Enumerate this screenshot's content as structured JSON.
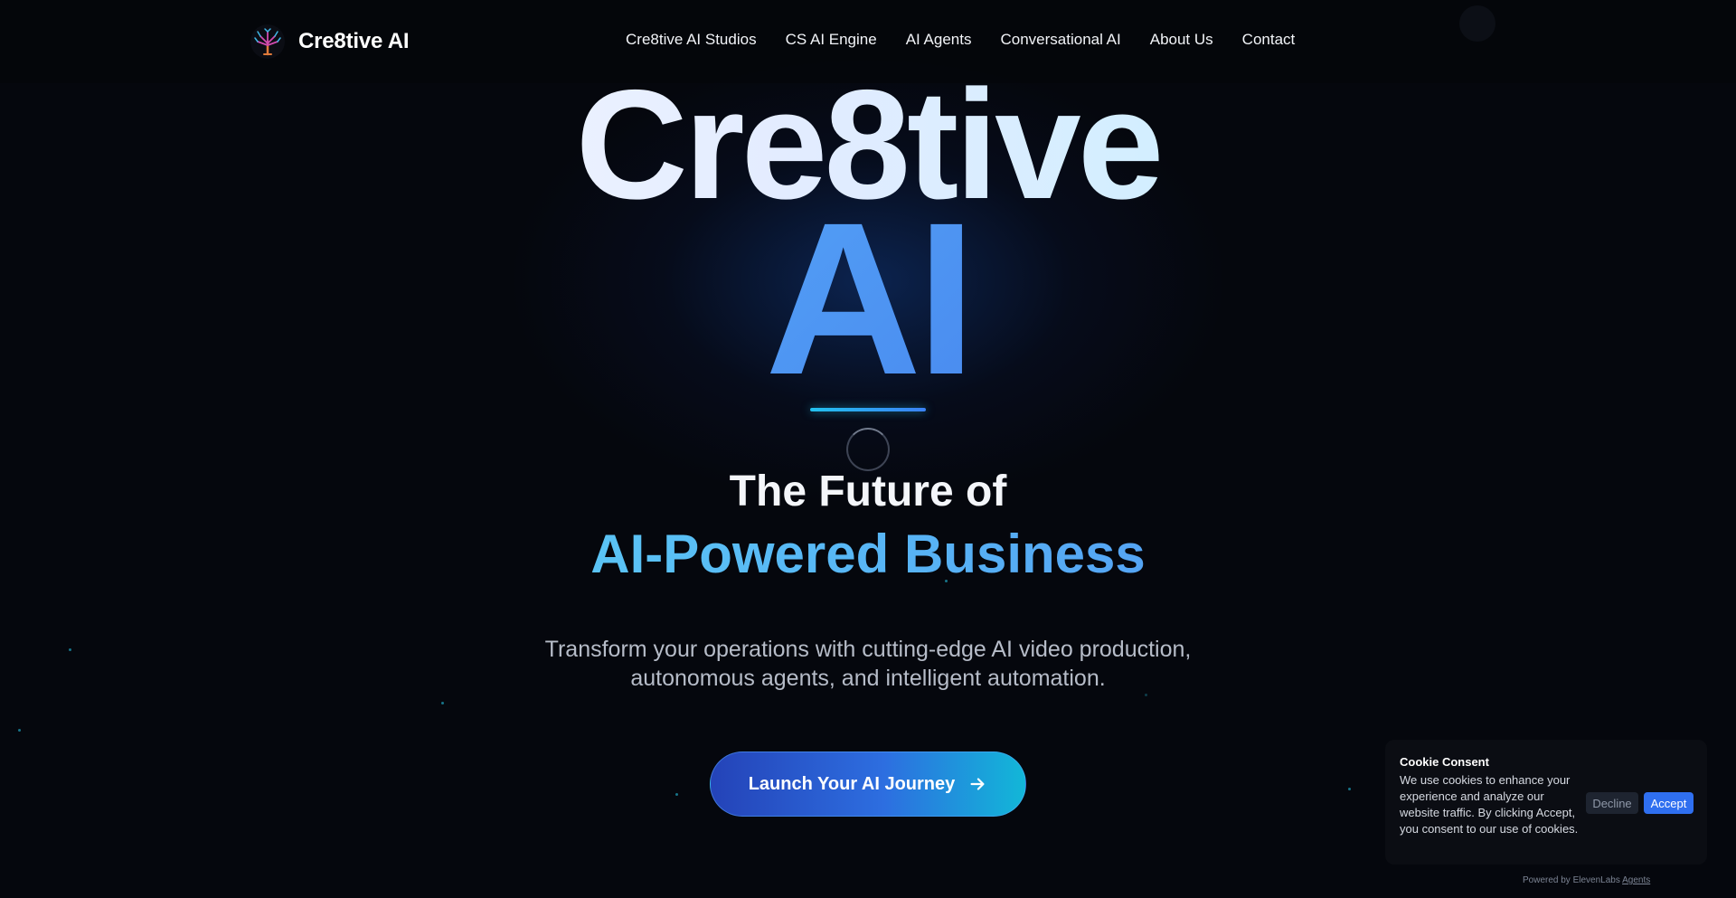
{
  "brand": {
    "name": "Cre8tive AI",
    "logo_icon": "tree-icon"
  },
  "nav": {
    "items": [
      {
        "label": "Cre8tive AI Studios"
      },
      {
        "label": "CS AI Engine"
      },
      {
        "label": "AI Agents"
      },
      {
        "label": "Conversational AI"
      },
      {
        "label": "About Us"
      },
      {
        "label": "Contact"
      }
    ]
  },
  "hero": {
    "word1": "Cre8tive",
    "word2": "AI",
    "tagline_line1": "The Future of",
    "tagline_line2": "AI-Powered Business",
    "description_line1": "Transform your operations with cutting-edge AI video production,",
    "description_line2": "autonomous agents, and intelligent automation.",
    "cta_label": "Launch Your AI Journey",
    "cta_icon": "arrow-right-icon"
  },
  "cookie": {
    "title": "Cookie Consent",
    "text": "We use cookies to enhance your experience and analyze our website traffic. By clicking Accept, you consent to our use of cookies.",
    "decline_label": "Decline",
    "accept_label": "Accept"
  },
  "footer": {
    "powered_prefix": "Powered by ElevenLabs",
    "powered_link": "Agents"
  },
  "colors": {
    "background": "#05070d",
    "accent_blue": "#3b82f6",
    "accent_cyan": "#22c1ee"
  }
}
